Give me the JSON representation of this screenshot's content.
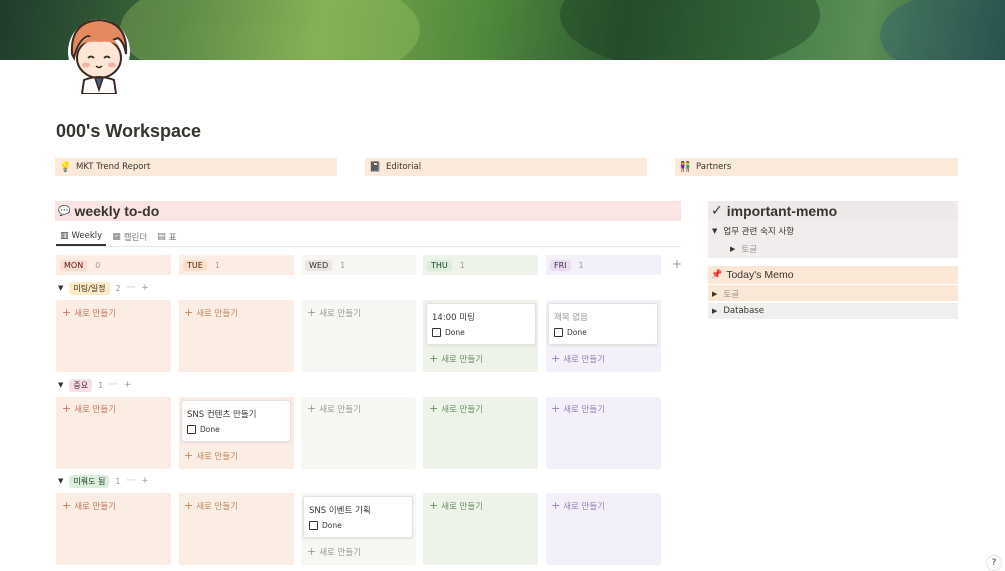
{
  "page": {
    "title": "000's Workspace"
  },
  "links": [
    {
      "icon": "lightbulb-icon",
      "label": "MKT Trend Report"
    },
    {
      "icon": "notebook-icon",
      "label": "Editorial"
    },
    {
      "icon": "people-icon",
      "label": "Partners"
    }
  ],
  "weekly": {
    "title": "weekly to-do",
    "views": [
      {
        "label": "Weekly"
      },
      {
        "label": "캘린더"
      },
      {
        "label": "표"
      }
    ],
    "columns": [
      {
        "label": "MON",
        "count": "0"
      },
      {
        "label": "TUE",
        "count": "1"
      },
      {
        "label": "WED",
        "count": "1"
      },
      {
        "label": "THU",
        "count": "1"
      },
      {
        "label": "FRI",
        "count": "1"
      }
    ],
    "groups": [
      {
        "label": "미팅/일정",
        "count": "2"
      },
      {
        "label": "중요",
        "count": "1"
      },
      {
        "label": "미뤄도 됨",
        "count": "1"
      }
    ],
    "new_label": "새로 만들기",
    "done_label": "Done",
    "cards": {
      "thu_meeting": "14:00 미팅",
      "fri_meeting": "제목 없음",
      "tue_important": "SNS 컨텐츠 만들기",
      "wed_later": "SNS 이벤트 기획"
    }
  },
  "sidebar": {
    "memo_title": "important-memo",
    "memo_toggle": "업무 관련 숙지 사항",
    "memo_sub": "토글",
    "today_title": "Today's Memo",
    "today_toggle": "토글",
    "database": "Database"
  },
  "help": "?",
  "colors": {
    "mon": "#fbece4",
    "tue": "#fbece4",
    "wed": "#f7f6f3",
    "thu": "#eef3ea",
    "fri": "#f4f0f9"
  }
}
